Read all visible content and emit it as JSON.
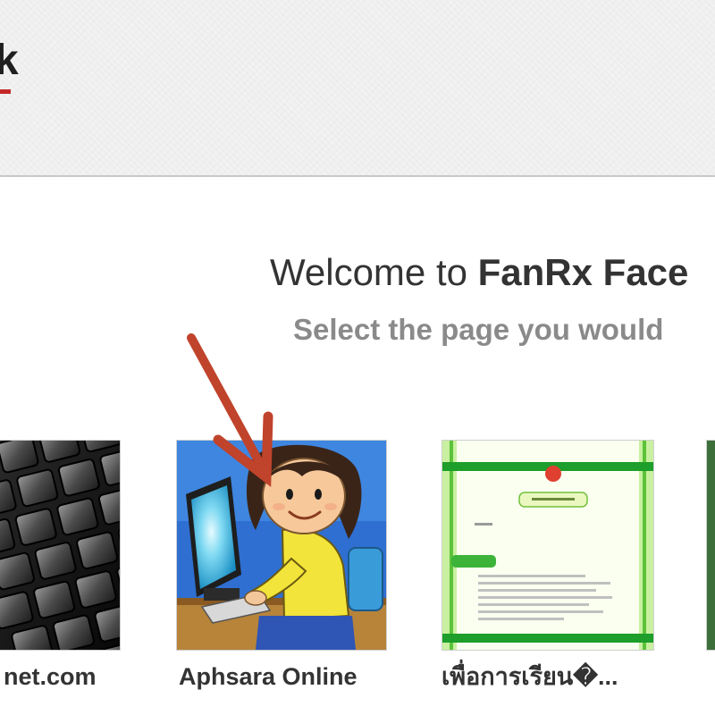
{
  "header": {
    "logo_fragment": "k"
  },
  "welcome": {
    "title_prefix": "Welcome to ",
    "title_brand": "FanRx Face",
    "subtitle": "Select the page you would"
  },
  "cards": [
    {
      "label": "net.com",
      "thumbnail": "keyboard-image"
    },
    {
      "label": "Aphsara Online",
      "thumbnail": "girl-at-computer-image"
    },
    {
      "label": "เพื่อการเรียน�...",
      "thumbnail": "green-page-screenshot"
    }
  ],
  "colors": {
    "arrow": "#c0432b",
    "banner": "#f2f2f2",
    "logo_accent": "#c62828",
    "subtitle": "#8a8a8a"
  },
  "annotation": {
    "arrow_icon": "red-arrow-icon"
  }
}
